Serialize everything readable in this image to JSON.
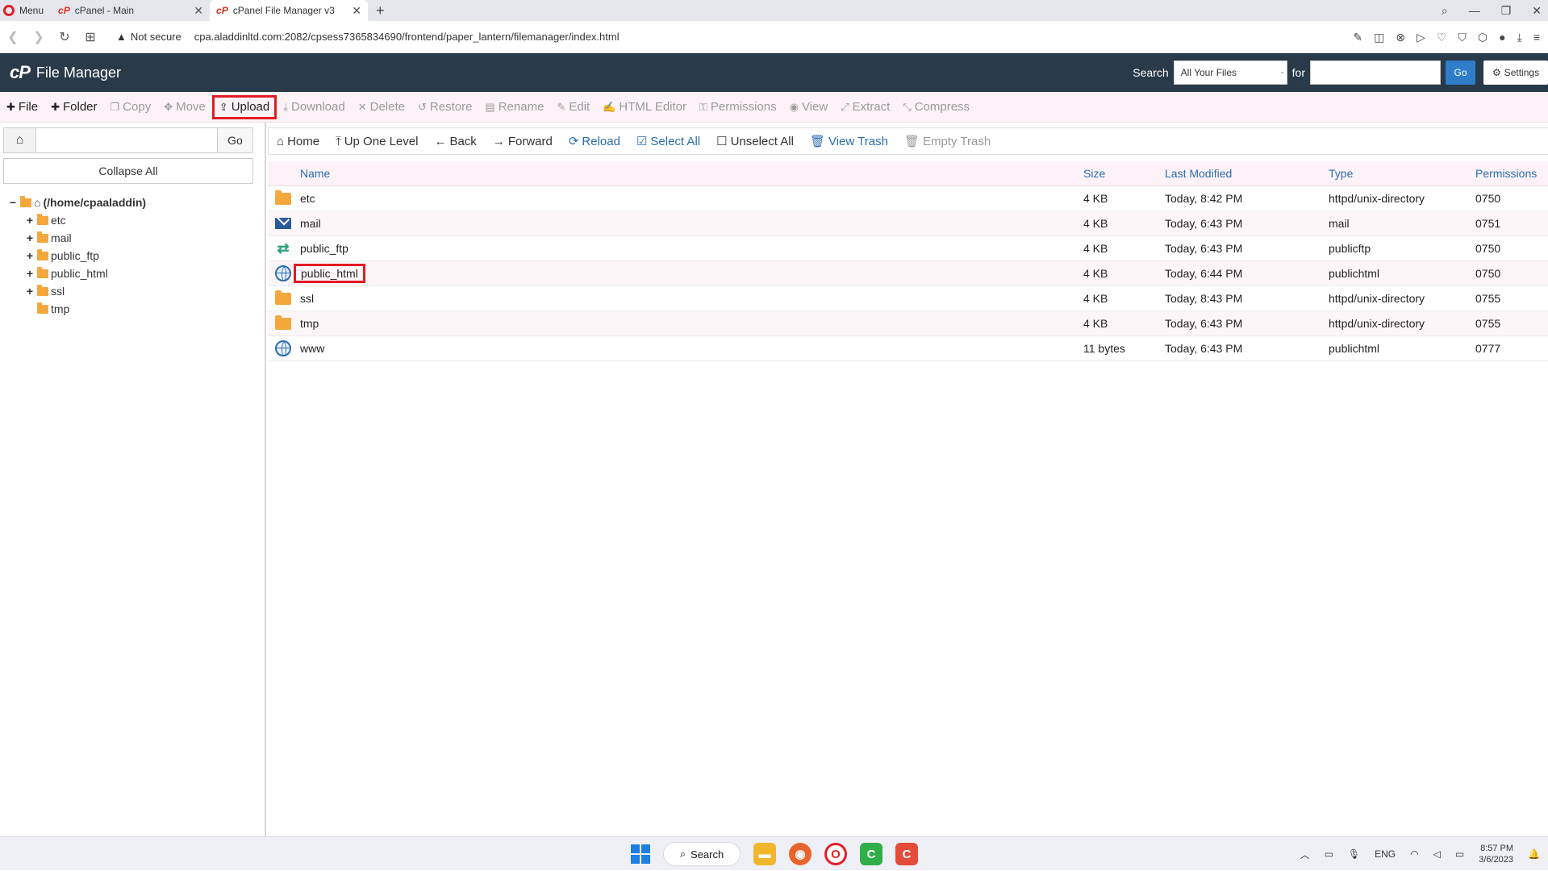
{
  "browser": {
    "menu_label": "Menu",
    "tabs": [
      {
        "title": "cPanel - Main"
      },
      {
        "title": "cPanel File Manager v3"
      }
    ],
    "security_label": "Not secure",
    "url": "cpa.aladdinltd.com:2082/cpsess7365834690/frontend/paper_lantern/filemanager/index.html"
  },
  "header": {
    "logo": "cP",
    "title": "File Manager",
    "search_label": "Search",
    "search_scope": "All Your Files",
    "for_label": "for",
    "search_value": "",
    "go_label": "Go",
    "settings_label": "Settings"
  },
  "toolbar": {
    "items": [
      {
        "label": "File",
        "icon": "plus-icon",
        "enabled": true
      },
      {
        "label": "Folder",
        "icon": "plus-icon",
        "enabled": true
      },
      {
        "label": "Copy",
        "icon": "copy-icon",
        "enabled": false
      },
      {
        "label": "Move",
        "icon": "move-icon",
        "enabled": false
      },
      {
        "label": "Upload",
        "icon": "upload-icon",
        "enabled": true,
        "highlighted": true
      },
      {
        "label": "Download",
        "icon": "download-icon",
        "enabled": false
      },
      {
        "label": "Delete",
        "icon": "delete-icon",
        "enabled": false
      },
      {
        "label": "Restore",
        "icon": "restore-icon",
        "enabled": false
      },
      {
        "label": "Rename",
        "icon": "rename-icon",
        "enabled": false
      },
      {
        "label": "Edit",
        "icon": "edit-icon",
        "enabled": false
      },
      {
        "label": "HTML Editor",
        "icon": "html-editor-icon",
        "enabled": false
      },
      {
        "label": "Permissions",
        "icon": "key-icon",
        "enabled": false
      },
      {
        "label": "View",
        "icon": "eye-icon",
        "enabled": false
      },
      {
        "label": "Extract",
        "icon": "extract-icon",
        "enabled": false
      },
      {
        "label": "Compress",
        "icon": "compress-icon",
        "enabled": false
      }
    ]
  },
  "sidebar": {
    "path_value": "",
    "go_label": "Go",
    "collapse_label": "Collapse All",
    "root_label": "(/home/cpaaladdin)",
    "tree": [
      {
        "label": "etc",
        "expandable": true
      },
      {
        "label": "mail",
        "expandable": true
      },
      {
        "label": "public_ftp",
        "expandable": true
      },
      {
        "label": "public_html",
        "expandable": true
      },
      {
        "label": "ssl",
        "expandable": true
      },
      {
        "label": "tmp",
        "expandable": false
      }
    ]
  },
  "navbar": {
    "items": [
      {
        "label": "Home",
        "icon": "home-icon",
        "style": "on"
      },
      {
        "label": "Up One Level",
        "icon": "up-level-icon",
        "style": "on"
      },
      {
        "label": "Back",
        "icon": "back-arrow-icon",
        "style": "on"
      },
      {
        "label": "Forward",
        "icon": "forward-arrow-icon",
        "style": "on"
      },
      {
        "label": "Reload",
        "icon": "reload-icon",
        "style": "blue"
      },
      {
        "label": "Select All",
        "icon": "checkbox-checked-icon",
        "style": "blue"
      },
      {
        "label": "Unselect All",
        "icon": "checkbox-empty-icon",
        "style": "on"
      },
      {
        "label": "View Trash",
        "icon": "trash-icon",
        "style": "blue"
      },
      {
        "label": "Empty Trash",
        "icon": "trash-icon",
        "style": "off"
      }
    ]
  },
  "table": {
    "headers": {
      "name": "Name",
      "size": "Size",
      "modified": "Last Modified",
      "type": "Type",
      "permissions": "Permissions"
    },
    "rows": [
      {
        "icon": "folder",
        "name": "etc",
        "size": "4 KB",
        "modified": "Today, 8:42 PM",
        "type": "httpd/unix-directory",
        "permissions": "0750"
      },
      {
        "icon": "mail",
        "name": "mail",
        "size": "4 KB",
        "modified": "Today, 6:43 PM",
        "type": "mail",
        "permissions": "0751"
      },
      {
        "icon": "ftp",
        "name": "public_ftp",
        "size": "4 KB",
        "modified": "Today, 6:43 PM",
        "type": "publicftp",
        "permissions": "0750"
      },
      {
        "icon": "globe",
        "name": "public_html",
        "size": "4 KB",
        "modified": "Today, 6:44 PM",
        "type": "publichtml",
        "permissions": "0750",
        "highlighted": true
      },
      {
        "icon": "folder",
        "name": "ssl",
        "size": "4 KB",
        "modified": "Today, 8:43 PM",
        "type": "httpd/unix-directory",
        "permissions": "0755"
      },
      {
        "icon": "folder",
        "name": "tmp",
        "size": "4 KB",
        "modified": "Today, 6:43 PM",
        "type": "httpd/unix-directory",
        "permissions": "0755"
      },
      {
        "icon": "globe-link",
        "name": "www",
        "size": "11 bytes",
        "modified": "Today, 6:43 PM",
        "type": "publichtml",
        "permissions": "0777"
      }
    ]
  },
  "taskbar": {
    "search_label": "Search",
    "tray_lang": "ENG",
    "time": "8:57 PM",
    "date": "3/6/2023"
  },
  "colors": {
    "header_bg": "#293a4a",
    "toolbar_bg": "#fcf2f7",
    "link_blue": "#2a6db0",
    "highlight_red": "#e11b22",
    "folder_orange": "#f4a73b"
  }
}
